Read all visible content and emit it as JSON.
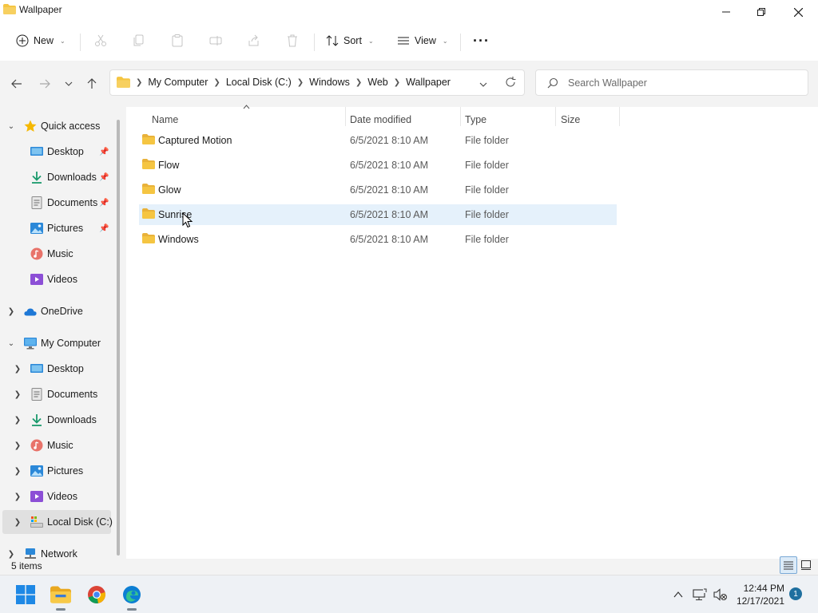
{
  "window": {
    "title": "Wallpaper"
  },
  "toolbar": {
    "new_label": "New",
    "sort_label": "Sort",
    "view_label": "View",
    "more_label": "···"
  },
  "address": {
    "crumbs": [
      "My Computer",
      "Local Disk (C:)",
      "Windows",
      "Web",
      "Wallpaper"
    ],
    "search_placeholder": "Search Wallpaper"
  },
  "nav": {
    "quick_access": "Quick access",
    "quick_items": [
      {
        "label": "Desktop",
        "pinned": true
      },
      {
        "label": "Downloads",
        "pinned": true
      },
      {
        "label": "Documents",
        "pinned": true
      },
      {
        "label": "Pictures",
        "pinned": true
      },
      {
        "label": "Music",
        "pinned": false
      },
      {
        "label": "Videos",
        "pinned": false
      }
    ],
    "onedrive": "OneDrive",
    "my_computer": "My Computer",
    "computer_items": [
      "Desktop",
      "Documents",
      "Downloads",
      "Music",
      "Pictures",
      "Videos",
      "Local Disk (C:)"
    ],
    "network": "Network"
  },
  "columns": {
    "name": "Name",
    "date": "Date modified",
    "type": "Type",
    "size": "Size"
  },
  "files": [
    {
      "name": "Captured Motion",
      "date": "6/5/2021 8:10 AM",
      "type": "File folder"
    },
    {
      "name": "Flow",
      "date": "6/5/2021 8:10 AM",
      "type": "File folder"
    },
    {
      "name": "Glow",
      "date": "6/5/2021 8:10 AM",
      "type": "File folder"
    },
    {
      "name": "Sunrise",
      "date": "6/5/2021 8:10 AM",
      "type": "File folder"
    },
    {
      "name": "Windows",
      "date": "6/5/2021 8:10 AM",
      "type": "File folder"
    }
  ],
  "status": {
    "count": "5 items"
  },
  "taskbar": {
    "time": "12:44 PM",
    "date": "12/17/2021",
    "notifications": "1"
  },
  "colors": {
    "accent": "#0067c0",
    "folder": "#f5c542",
    "hover_row": "#e5f1fb"
  }
}
